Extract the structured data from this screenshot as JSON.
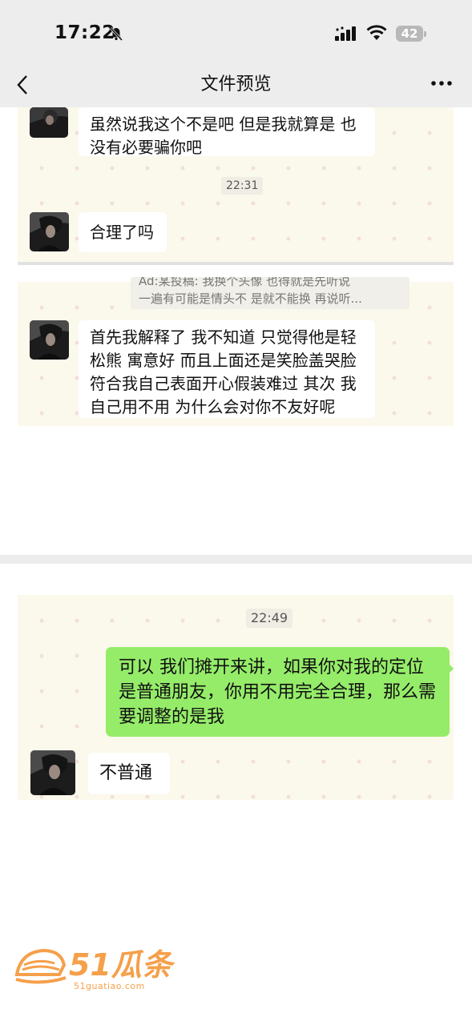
{
  "status_bar": {
    "time": "17:22",
    "battery": "42"
  },
  "nav": {
    "title": "文件预览"
  },
  "panel1": {
    "message1": "虽然说我这个不是吧 但是我就算是 也没有必要骗你吧",
    "timestamp": "22:31",
    "message2": "合理了吗"
  },
  "panel2": {
    "quote_line1": "Ad:某投稿:    我换个头像 也得就是先听说",
    "quote_line2": "一遍有可能是情头不 是就不能换 再说听...",
    "message1": "首先我解释了 我不知道 只觉得他是轻松熊 寓意好 而且上面还是笑脸盖哭脸 符合我自己表面开心假装难过 其次 我自己用不用 为什么会对你不友好呢"
  },
  "panel3": {
    "timestamp": "22:49",
    "message_sent": "可以 我们摊开来讲，如果你对我的定位是普通朋友，你用不用完全合理，那么需要调整的是我",
    "message_received": "不普通"
  },
  "watermark": {
    "brand": "51瓜条",
    "url": "51guatiao.com"
  },
  "colors": {
    "sent_bubble": "#95ec69",
    "chat_background": "#fbf8ec",
    "watermark": "#f5a04a"
  }
}
